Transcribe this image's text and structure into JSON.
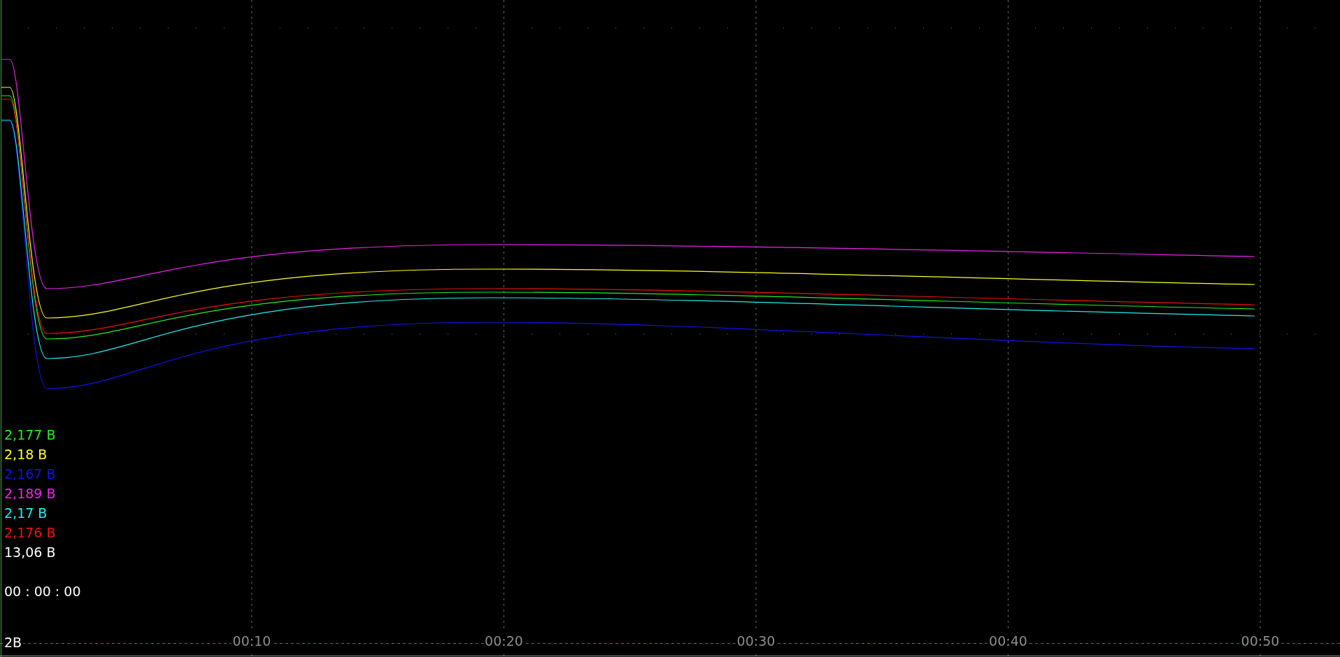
{
  "readings": [
    {
      "text": "2,177 В",
      "color": "#22ee22"
    },
    {
      "text": "2,18 В",
      "color": "#ffff22"
    },
    {
      "text": "2,167 В",
      "color": "#1111ee"
    },
    {
      "text": "2,189 В",
      "color": "#ee22ee"
    },
    {
      "text": "2,17 В",
      "color": "#22eeee"
    },
    {
      "text": "2,176 В",
      "color": "#ee1111"
    },
    {
      "text": "13,06 В",
      "color": "#ffffff"
    }
  ],
  "timer": "00 : 00 : 00",
  "scale_label": "2В",
  "time_ticks": [
    "00:10",
    "00:20",
    "00:30",
    "00:40",
    "00:50"
  ]
}
